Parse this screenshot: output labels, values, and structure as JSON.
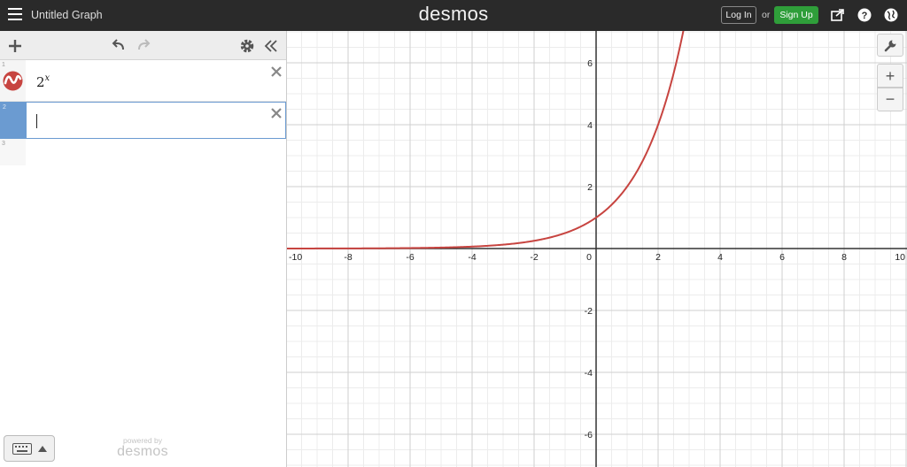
{
  "topbar": {
    "title": "Untitled Graph",
    "logo": "desmos",
    "login_label": "Log In",
    "or_label": "or",
    "signup_label": "Sign Up"
  },
  "expressions": [
    {
      "number": "1",
      "base": "2",
      "exponent": "x",
      "color": "#c74440"
    },
    {
      "number": "2",
      "value": ""
    },
    {
      "number": "3"
    }
  ],
  "footer": {
    "powered_by": "powered by",
    "brand": "desmos"
  },
  "graph": {
    "x_range": [
      -10,
      10
    ],
    "y_range": [
      -7,
      7
    ],
    "x_ticks": [
      "-10",
      "-8",
      "-6",
      "-4",
      "-2",
      "0",
      "2",
      "4",
      "6",
      "8",
      "10"
    ],
    "y_ticks": [
      "6",
      "4",
      "2",
      "-2",
      "-4",
      "-6"
    ],
    "curve": "2^x",
    "curve_color": "#c74440"
  },
  "graph_tools": {
    "zoom_in_label": "+",
    "zoom_out_label": "−"
  }
}
